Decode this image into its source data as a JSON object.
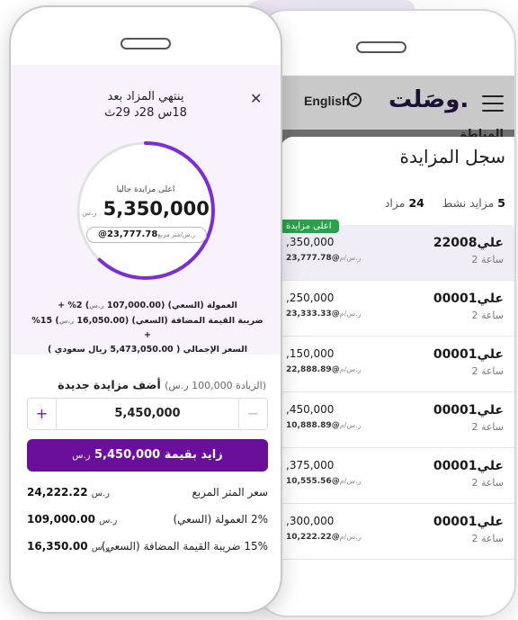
{
  "back": {
    "nav": {
      "lang": "English",
      "logo": "وصَلت.",
      "globe_icon": "globe-icon",
      "menu_icon": "hamburger-icon",
      "strip_text": "المناطق"
    },
    "sheet_title": "سجل المزايدة",
    "stats": {
      "active_count": "5",
      "active_label": "مزايد نشط",
      "bids_count": "24",
      "bids_label": "مزاد"
    },
    "badge": "اعلى مزايدة",
    "rows": [
      {
        "name": "علي22008",
        "time": "2 ساعة",
        "amount": ",350,000",
        "ppm": "@23,777.78",
        "ppm_unit": "ر.س/م"
      },
      {
        "name": "علي00001",
        "time": "2 ساعة",
        "amount": ",250,000",
        "ppm": "@23,333.33",
        "ppm_unit": "ر.س/م"
      },
      {
        "name": "علي00001",
        "time": "2 ساعة",
        "amount": ",150,000",
        "ppm": "@22,888.89",
        "ppm_unit": "ر.س/م"
      },
      {
        "name": "علي00001",
        "time": "2 ساعة",
        "amount": ",450,000",
        "ppm": "@10,888.89",
        "ppm_unit": "ر.س/م"
      },
      {
        "name": "علي00001",
        "time": "2 ساعة",
        "amount": ",375,000",
        "ppm": "@10,555.56",
        "ppm_unit": "ر.س/م"
      },
      {
        "name": "علي00001",
        "time": "2 ساعة",
        "amount": ",300,000",
        "ppm": "@10,222.22",
        "ppm_unit": "ر.س/م"
      }
    ]
  },
  "front": {
    "close": "✕",
    "ends_label": "ينتهي المزاد بعد",
    "ends_time": "18س 28د 29ث",
    "ring_progress": 0.62,
    "highest_label": "اعلى مزايدة حاليا",
    "highest_value": "5,350,000",
    "currency": "ر.س",
    "ppm_value": "@23,777.78",
    "ppm_unit": "ر.س/متر مربع",
    "fees": {
      "line1_pre": "العمولة (السعي) (",
      "line1_val": "107,000.00",
      "line1_post": ") 2% +",
      "line2_pre": "ضريبة القيمة المضافة (السعي) (",
      "line2_val": "16,050.00",
      "line2_post": ") 15% +",
      "line3": "السعر الإجمالي ( 5,473,050.00 ريال سعودي )"
    },
    "add_title": "أضف مزايدة جديدة",
    "add_hint": "(الزيادة 100,000 ر.س)",
    "stepper_value": "5,450,000",
    "plus": "+",
    "minus": "−",
    "bid_button": {
      "prefix": "زايد بقيمة",
      "amount": "5,450,000",
      "unit": "ر.س"
    },
    "info": [
      {
        "label": "سعر المتر المربع",
        "value": "24,222.22",
        "unit": "ر.س"
      },
      {
        "label": "2% العمولة (السعي)",
        "value": "109,000.00",
        "unit": "ر.س"
      },
      {
        "label": "15% ضريبة القيمة المضافة (السعي)",
        "value": "16,350.00",
        "unit": "ر.س"
      }
    ]
  },
  "colors": {
    "accent": "#6a0e9c",
    "badge": "#2e9e4f",
    "panel": "#f7f2fb"
  }
}
